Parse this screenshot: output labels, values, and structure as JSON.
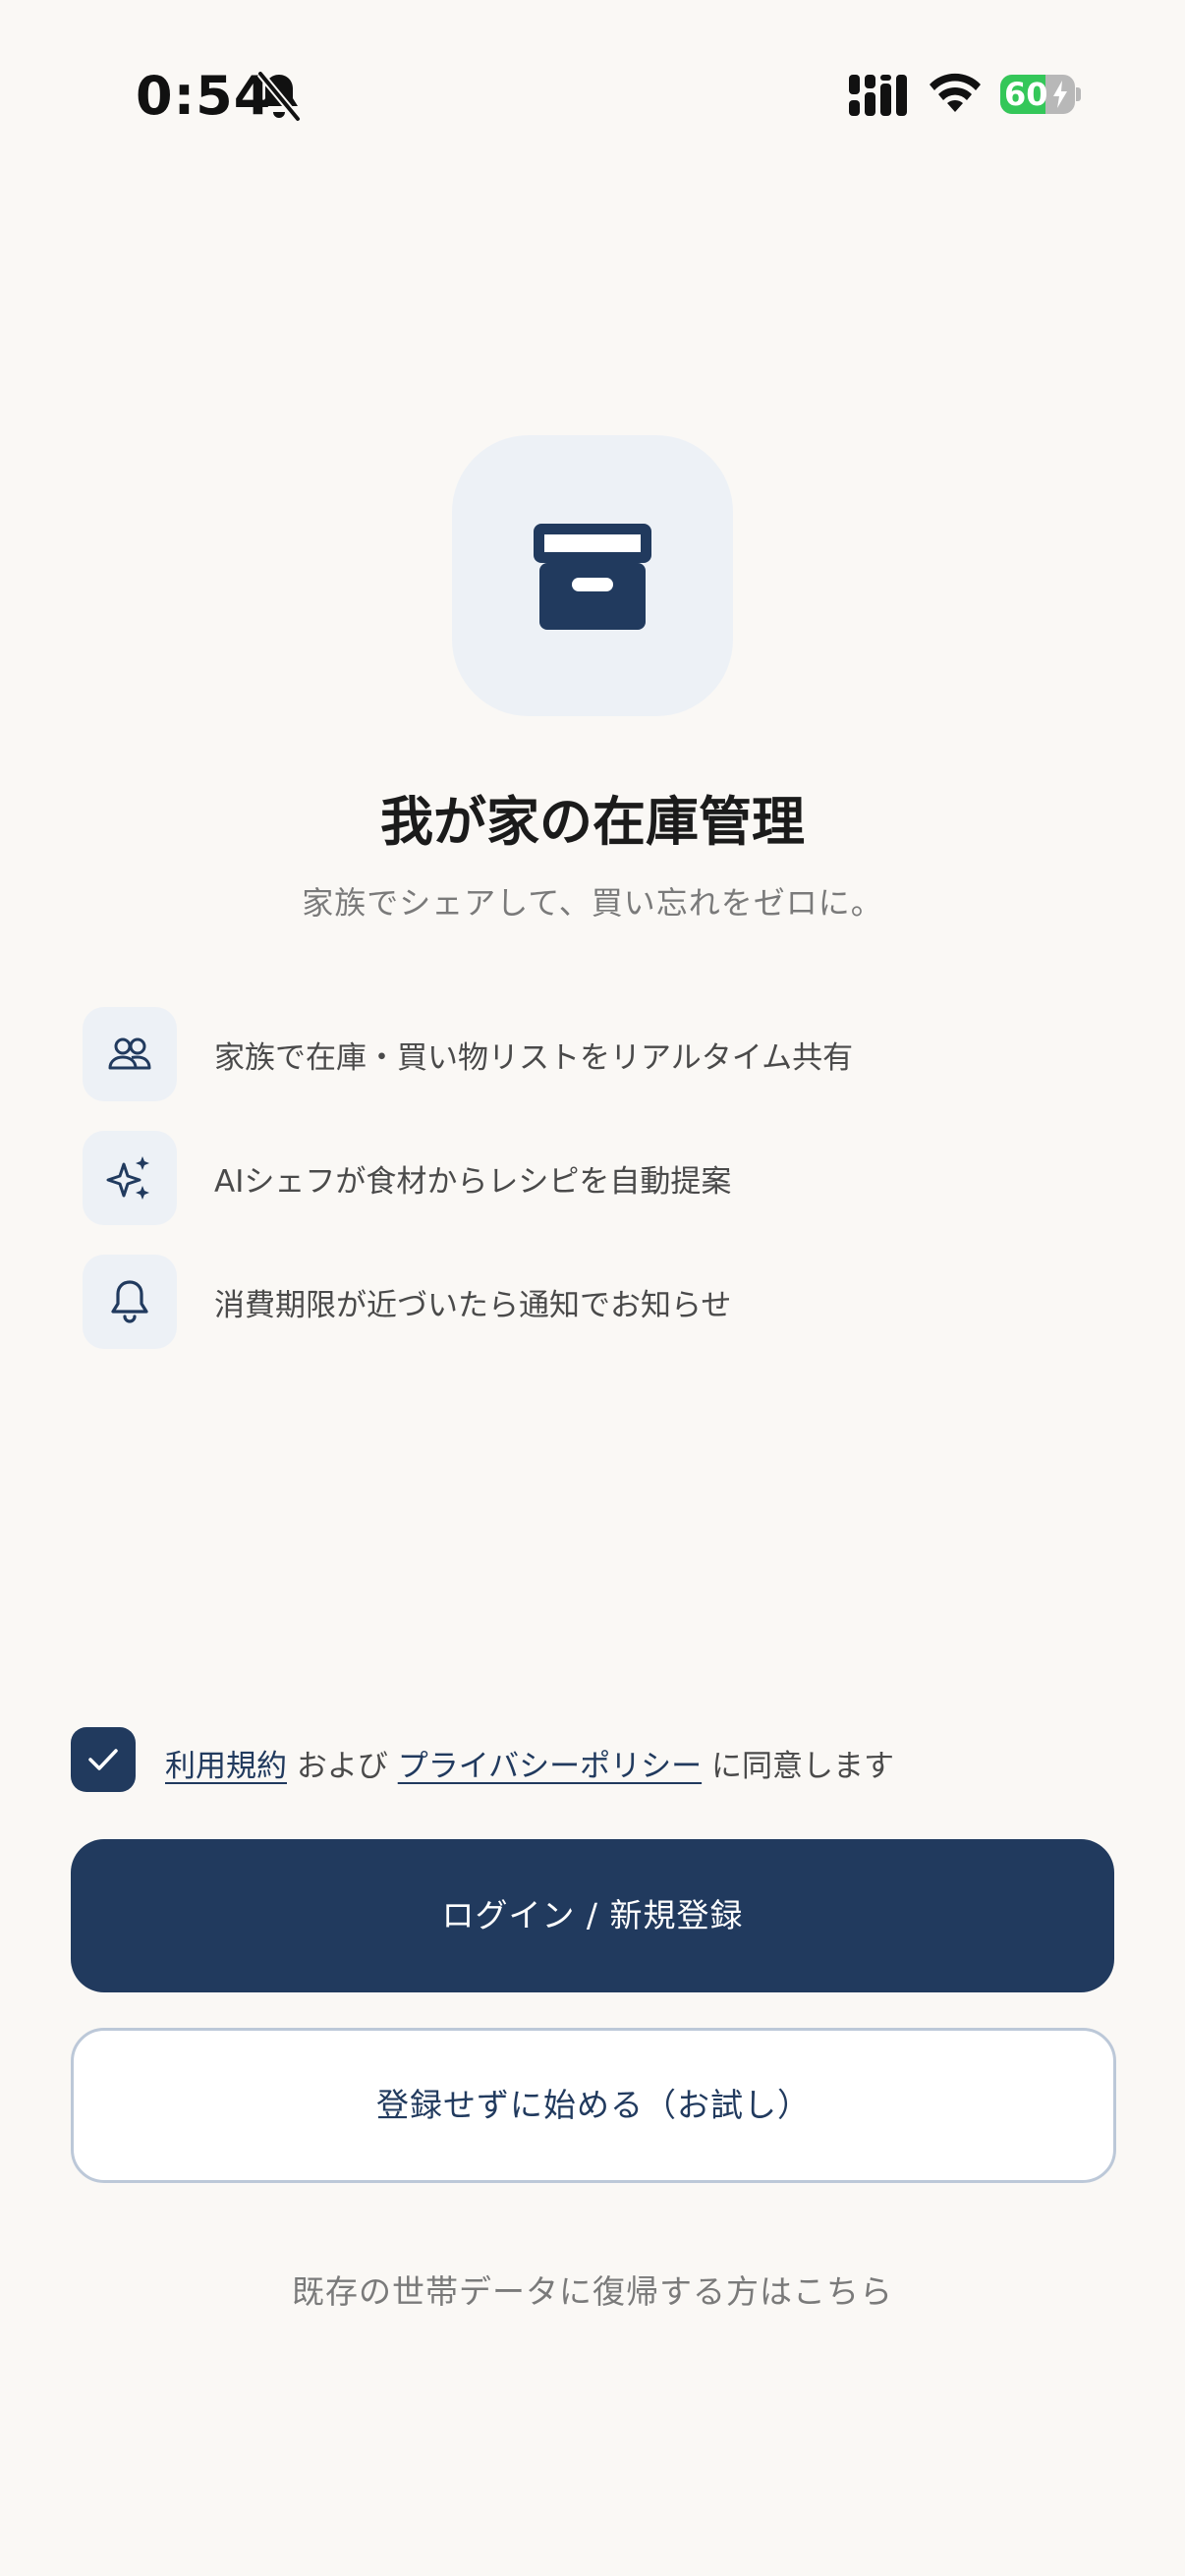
{
  "status_bar": {
    "time": "0:54",
    "battery_level": 60,
    "battery_text": "60",
    "icons": [
      "bell-off-icon",
      "cellular-signal-icon",
      "wifi-icon",
      "battery-charging-icon"
    ]
  },
  "app": {
    "icon": "archive-box-icon",
    "title": "我が家の在庫管理",
    "subtitle": "家族でシェアして、買い忘れをゼロに。"
  },
  "features": [
    {
      "icon": "users-icon",
      "text": "家族で在庫・買い物リストをリアルタイム共有"
    },
    {
      "icon": "sparkles-icon",
      "text": "AIシェフが食材からレシピを自動提案"
    },
    {
      "icon": "bell-icon",
      "text": "消費期限が近づいたら通知でお知らせ"
    }
  ],
  "consent": {
    "checked": true,
    "terms_link": "利用規約",
    "and_text": " および ",
    "privacy_link": "プライバシーポリシー",
    "agree_text": " に同意します"
  },
  "buttons": {
    "login_label": "ログイン / 新規登録",
    "trial_label": "登録せずに始める（お試し）"
  },
  "restore_link": "既存の世帯データに復帰する方はこちら",
  "colors": {
    "background": "#FAF8F5",
    "primary": "#213A5E",
    "icon_tile": "#EDF1F6",
    "battery_green": "#34C759"
  }
}
